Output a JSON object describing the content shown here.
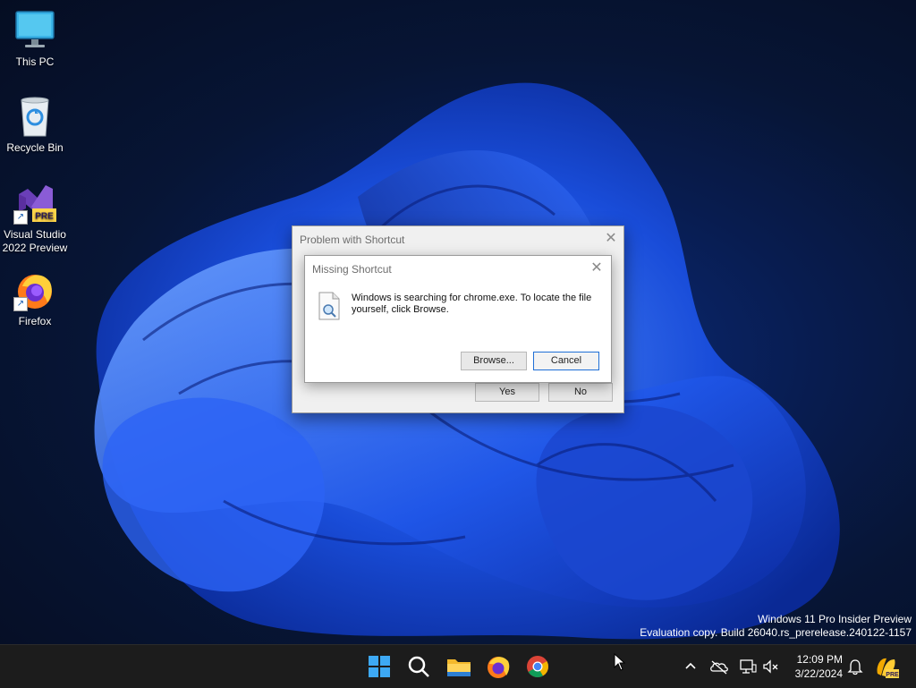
{
  "desktop": {
    "icons": [
      {
        "label": "This PC"
      },
      {
        "label": "Recycle Bin"
      },
      {
        "label": "Visual Studio 2022 Preview",
        "line1": "Visual Studio",
        "line2": "2022 Preview",
        "badge": "PRE"
      },
      {
        "label": "Firefox"
      }
    ],
    "watermark": {
      "line1": "Windows 11 Pro Insider Preview",
      "line2": "Evaluation copy. Build 26040.rs_prerelease.240122-1157"
    }
  },
  "outer_dialog": {
    "title": "Problem with Shortcut",
    "yes_label": "Yes",
    "no_label": "No"
  },
  "inner_dialog": {
    "title": "Missing Shortcut",
    "message": "Windows is searching for chrome.exe. To locate the file yourself, click Browse.",
    "browse_label": "Browse...",
    "cancel_label": "Cancel"
  },
  "taskbar": {
    "apps": [
      "start-icon",
      "search-icon",
      "file-explorer-icon",
      "firefox-icon",
      "chrome-icon"
    ],
    "tray": [
      "chevron-up-icon",
      "onedrive-icon",
      "network-icon",
      "volume-muted-icon",
      "notification-bell-icon",
      "copilot-icon"
    ],
    "time": "12:09 PM",
    "date": "3/22/2024"
  }
}
